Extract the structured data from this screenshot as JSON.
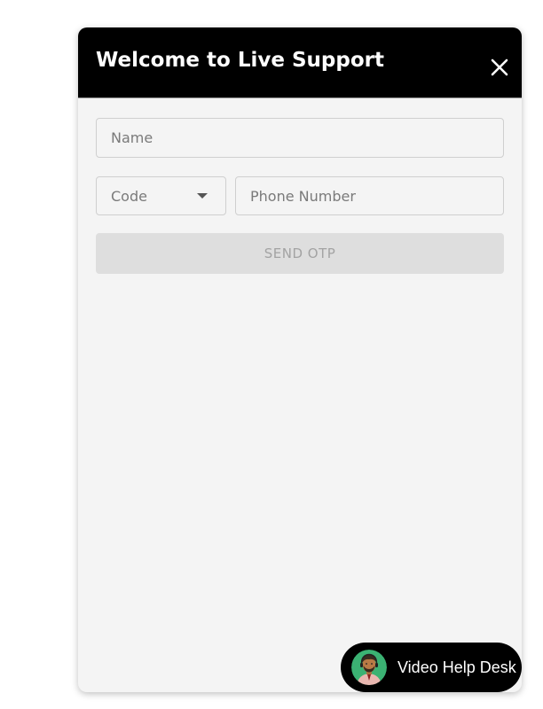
{
  "header": {
    "title": "Welcome to Live Support",
    "close_icon": "close-icon"
  },
  "form": {
    "name": {
      "placeholder": "Name",
      "value": ""
    },
    "code": {
      "placeholder": "Code",
      "value": "",
      "icon": "chevron-down-icon"
    },
    "phone": {
      "placeholder": "Phone Number",
      "value": ""
    },
    "send_label": "SEND OTP"
  },
  "help_desk": {
    "label": "Video Help Desk",
    "avatar_icon": "support-agent-avatar"
  },
  "colors": {
    "header_bg": "#000000",
    "panel_bg": "#f4f4f4",
    "button_disabled_bg": "#dedede",
    "button_disabled_text": "#a3a3a3"
  }
}
